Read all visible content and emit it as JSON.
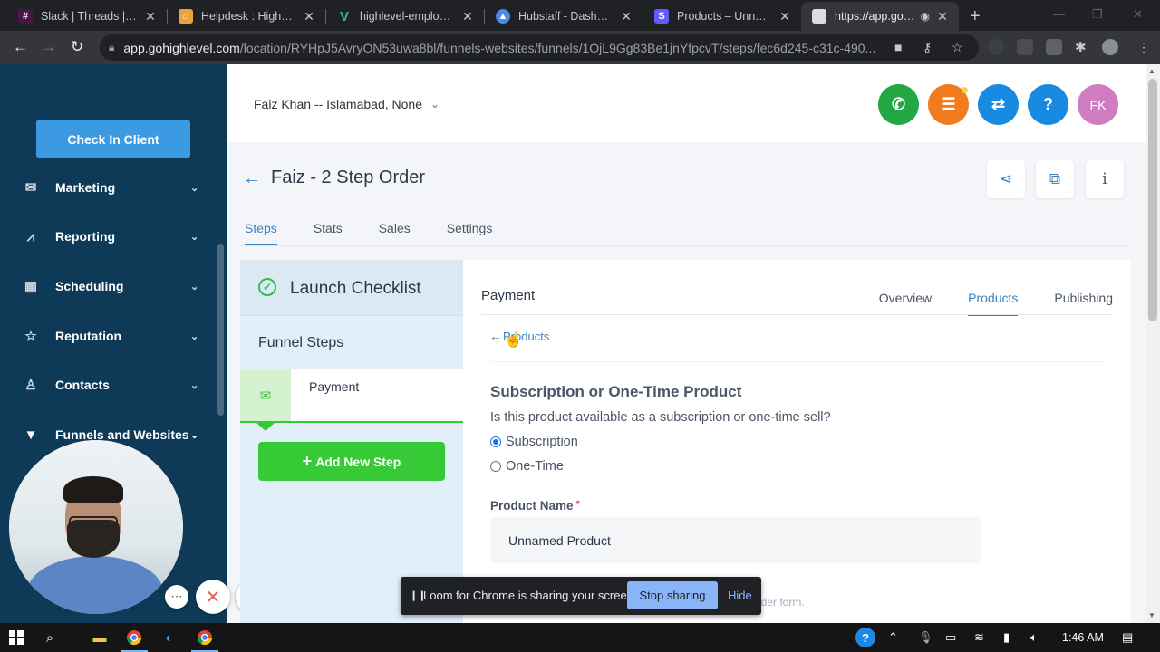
{
  "browser": {
    "tabs": [
      {
        "title": "Slack | Threads | GoHighLevel",
        "favicon": "slack-icon",
        "color": "#4a154b"
      },
      {
        "title": "Helpdesk : HighLevel",
        "favicon": "freshdesk-icon",
        "color": "#e8a33a"
      },
      {
        "title": "highlevel-employee",
        "favicon": "vue-icon",
        "color": "#41b883"
      },
      {
        "title": "Hubstaff - Dashboard",
        "favicon": "hubstaff-icon",
        "color": "#4a89e8"
      },
      {
        "title": "Products – Unnamed",
        "favicon": "stripe-icon",
        "color": "#635bff"
      },
      {
        "title": "https://app.gohighlevel.com",
        "favicon": "page-icon",
        "color": "#dadce0"
      }
    ],
    "url_host": "app.gohighlevel.com",
    "url_path": "/location/RYHpJ5AvryON53uwa8bl/funnels-websites/funnels/1OjL9Gg83Be1jnYfpcvT/steps/fec6d245-c31c-490..."
  },
  "sidebar": {
    "checkin_label": "Check In Client",
    "items": [
      {
        "label": "Marketing",
        "icon": "mail-icon"
      },
      {
        "label": "Reporting",
        "icon": "chart-icon"
      },
      {
        "label": "Scheduling",
        "icon": "calendar-icon"
      },
      {
        "label": "Reputation",
        "icon": "star-icon"
      },
      {
        "label": "Contacts",
        "icon": "person-icon"
      },
      {
        "label": "Funnels and Websites",
        "icon": "filter-icon"
      }
    ]
  },
  "header": {
    "location": "Faiz Khan -- Islamabad, None",
    "avatar_initials": "FK",
    "colors": {
      "phone": "#22a744",
      "tasks": "#f27b1d",
      "switch": "#188ae2",
      "help": "#188ae2",
      "avatar": "#d07cc1"
    }
  },
  "funnel": {
    "title": "Faiz - 2 Step Order",
    "tabs": [
      "Steps",
      "Stats",
      "Sales",
      "Settings"
    ],
    "active_tab": "Steps"
  },
  "steps_panel": {
    "checklist_title": "Launch Checklist",
    "funnel_steps_title": "Funnel Steps",
    "steps": [
      {
        "label": "Payment"
      }
    ],
    "add_step_label": "Add New Step"
  },
  "main": {
    "title": "Payment",
    "tabs": [
      "Overview",
      "Products",
      "Publishing"
    ],
    "active_tab": "Products",
    "back_label": "Products",
    "section_title": "Subscription or One-Time Product",
    "question": "Is this product available as a subscription or one-time sell?",
    "options": [
      "Subscription",
      "One-Time"
    ],
    "selected_option": "Subscription",
    "product_name_label": "Product Name",
    "product_name_value": "Unnamed Product",
    "hint_fragment": "order form."
  },
  "loom": {
    "message": "Loom for Chrome is sharing your screen.",
    "stop_label": "Stop sharing",
    "hide_label": "Hide"
  },
  "taskbar": {
    "time": "1:46 AM"
  }
}
